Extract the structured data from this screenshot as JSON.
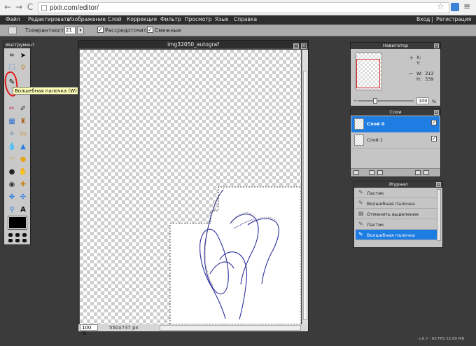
{
  "browser": {
    "url": "pixlr.com/editor/",
    "back_icon": "←",
    "forward_icon": "→",
    "reload_icon": "C"
  },
  "menu": {
    "items": [
      "Файл",
      "Редактировать",
      "Изображение",
      "Слой",
      "Коррекция",
      "Фильтр",
      "Просмотр",
      "Язык",
      "Справка"
    ],
    "login": "Вход",
    "separator": "|",
    "register": "Регистрация"
  },
  "options": {
    "tolerance_label": "Толерантность",
    "tolerance_value": "21",
    "contiguous_label": "Рассредоточить",
    "antialias_label": "Смежные",
    "contiguous_checked": "✓",
    "antialias_checked": "✓"
  },
  "tools": {
    "title": "Инструмент",
    "tooltip": "Волшебная палочка (W)",
    "foreground_color": "#000000"
  },
  "document": {
    "title": "img32050_autograf",
    "zoom": "100",
    "zoom_unit": "%",
    "size": "550x737 px"
  },
  "navigator": {
    "title": "Навигатор",
    "x_label": "X:",
    "y_label": "Y:",
    "w_label": "W:",
    "w_value": "313",
    "h_label": "H:",
    "h_value": "339",
    "zoom": "100",
    "zoom_unit": "%"
  },
  "layers": {
    "title": "Слои",
    "items": [
      {
        "name": "Слой 0",
        "selected": true
      },
      {
        "name": "Слой 1",
        "selected": false
      }
    ]
  },
  "history": {
    "title": "Журнал",
    "items": [
      {
        "label": "Ластик",
        "selected": false
      },
      {
        "label": "Волшебная палочка",
        "selected": false
      },
      {
        "label": "Отменить выделение",
        "selected": false
      },
      {
        "label": "Ластик",
        "selected": false
      },
      {
        "label": "Волшебная палочка",
        "selected": true
      }
    ]
  },
  "footer": {
    "version": "v.6.7 - 60 FPS 32.89 MB"
  },
  "colors": {
    "accent": "#1e7de2",
    "annotation": "#e21919",
    "signature": "#2a2f9a"
  }
}
